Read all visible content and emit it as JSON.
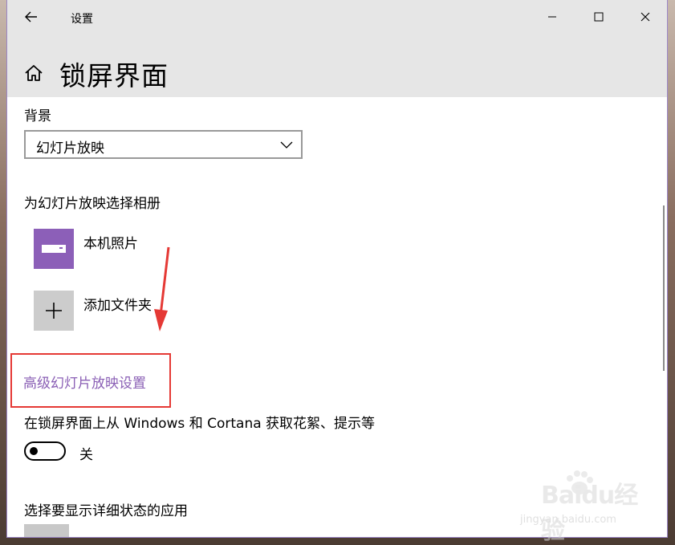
{
  "window": {
    "title": "设置",
    "controls": {
      "minimize_icon": "minimize-icon",
      "maximize_icon": "maximize-icon",
      "close_icon": "close-icon"
    }
  },
  "header": {
    "page_title": "锁屏界面",
    "home_icon": "home-icon",
    "back_icon": "back-arrow-icon"
  },
  "background_section": {
    "label": "背景",
    "dropdown_value": "幻灯片放映"
  },
  "album_section": {
    "label": "为幻灯片放映选择相册",
    "items": [
      {
        "label": "本机照片",
        "icon": "pictures-folder-icon",
        "color": "#8c5fb8"
      },
      {
        "label": "添加文件夹",
        "icon": "plus-icon",
        "color": "#cccccc"
      }
    ]
  },
  "advanced_link": "高级幻灯片放映设置",
  "cortana_section": {
    "label": "在锁屏界面上从 Windows 和 Cortana 获取花絮、提示等",
    "toggle_state": "关",
    "toggle_on": false
  },
  "apps_section": {
    "label": "选择要显示详细状态的应用"
  },
  "watermark": {
    "brand": "Baidu经验",
    "url": "jingyan.baidu.com"
  },
  "colors": {
    "accent": "#8a5fb5",
    "highlight_box": "#e53935",
    "header_bg": "#e6e6e6"
  }
}
